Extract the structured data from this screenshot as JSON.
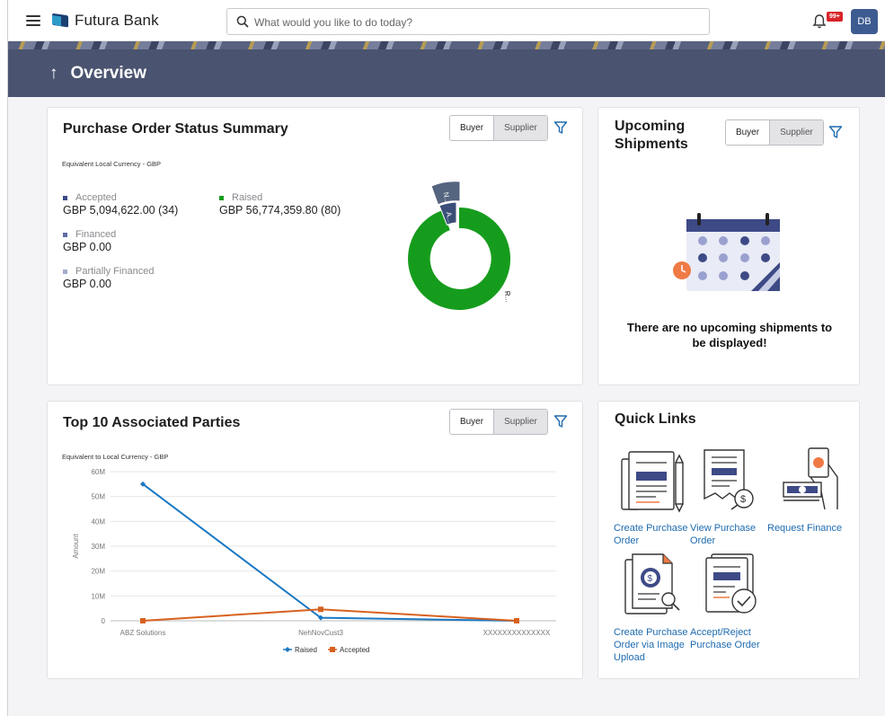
{
  "header": {
    "brand": "Futura Bank",
    "search_placeholder": "What would you like to do today?",
    "notification_badge": "99+",
    "avatar_initials": "DB"
  },
  "banner": {
    "back_arrow": "↑",
    "title": "Overview"
  },
  "po_summary": {
    "title": "Purchase Order Status Summary",
    "toggle": {
      "buyer": "Buyer",
      "supplier": "Supplier"
    },
    "currency_note": "Equivalent Local Currency - GBP",
    "legend": [
      {
        "label": "Accepted",
        "value": "GBP 5,094,622.00  (34)",
        "color": "#3e4a86"
      },
      {
        "label": "Raised",
        "value": "GBP 56,774,359.80  (80)",
        "color": "#169c1d"
      },
      {
        "label": "Financed",
        "value": "GBP 0.00",
        "color": "#5f6ea5"
      },
      {
        "label": "Partially Financed",
        "value": "GBP 0.00",
        "color": "#a4acd0"
      }
    ],
    "donut_labels": {
      "raised": "R...",
      "accepted": "A...",
      "other": "N..."
    },
    "colors": {
      "raised": "#169c1d",
      "accepted": "#3b4e78",
      "other": "#56657f"
    }
  },
  "upcoming_shipments": {
    "title_line1": "Upcoming",
    "title_line2": "Shipments",
    "toggle": {
      "buyer": "Buyer",
      "supplier": "Supplier"
    },
    "empty_message_line1": "There are no upcoming shipments to",
    "empty_message_line2": "be displayed!"
  },
  "top_parties": {
    "title": "Top 10 Associated Parties",
    "toggle": {
      "buyer": "Buyer",
      "supplier": "Supplier"
    },
    "currency_note": "Equivalent to Local Currency - GBP"
  },
  "chart_data": {
    "type": "line",
    "ylabel": "Amount",
    "xlabel": "",
    "categories": [
      "ABZ Solutions",
      "NehNovCust3",
      "XXXXXXXXXXXXXX"
    ],
    "ylim": [
      0,
      60000000
    ],
    "ytick_labels": [
      "0",
      "10M",
      "20M",
      "30M",
      "40M",
      "50M",
      "60M"
    ],
    "ytick_values": [
      0,
      10000000,
      20000000,
      30000000,
      40000000,
      50000000,
      60000000
    ],
    "grid": true,
    "legend_position": "bottom",
    "series": [
      {
        "name": "Raised",
        "values": [
          55000000,
          1200000,
          0
        ],
        "color": "#1a78c2"
      },
      {
        "name": "Accepted",
        "values": [
          0,
          4600000,
          0
        ],
        "color": "#d7611f"
      }
    ]
  },
  "quick_links": {
    "title": "Quick Links",
    "items": [
      {
        "line1": "Create Purchase",
        "line2": "Order",
        "line3": ""
      },
      {
        "line1": "View Purchase",
        "line2": "Order",
        "line3": ""
      },
      {
        "line1": "Request Finance",
        "line2": "",
        "line3": ""
      },
      {
        "line1": "Create Purchase",
        "line2": "Order via Image",
        "line3": "Upload"
      },
      {
        "line1": "Accept/Reject",
        "line2": "Purchase Order",
        "line3": ""
      }
    ]
  }
}
